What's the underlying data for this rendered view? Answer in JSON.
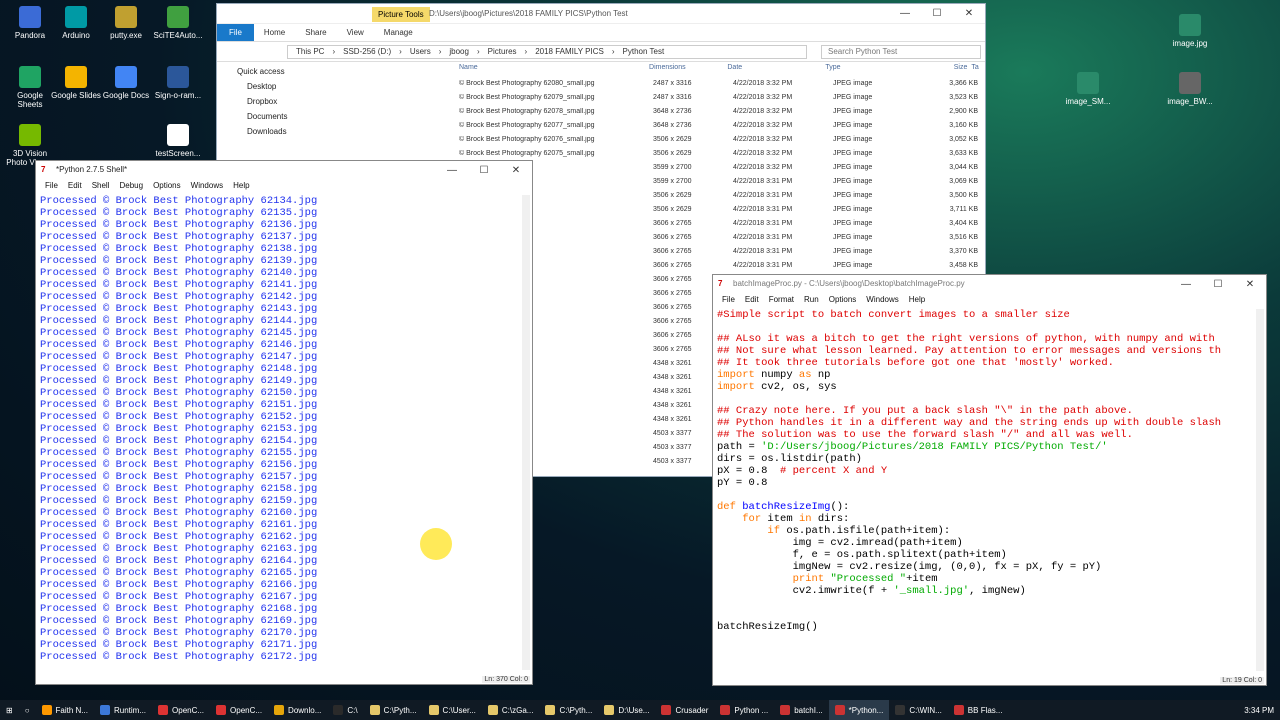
{
  "desktop_icons": [
    {
      "label": "Pandora",
      "color": "#3b6bd6"
    },
    {
      "label": "Arduino",
      "color": "#009aa5"
    },
    {
      "label": "putty.exe",
      "color": "#c0a030"
    },
    {
      "label": "SciTE4Auto...",
      "color": "#40a040"
    },
    {
      "label": "Google Sheets",
      "color": "#1fa463"
    },
    {
      "label": "Google Slides",
      "color": "#f4b400"
    },
    {
      "label": "Google Docs",
      "color": "#4285f4"
    },
    {
      "label": "Sign-o-ram...",
      "color": "#2b579a"
    },
    {
      "label": "3D Vision Photo Viewer",
      "color": "#76b900"
    },
    {
      "label": "testScreen...",
      "color": "#ffffff"
    },
    {
      "label": "image.jpg",
      "color": "#2a8a6a"
    },
    {
      "label": "image_SM...",
      "color": "#2a8a6a"
    },
    {
      "label": "image_BW...",
      "color": "#666666"
    }
  ],
  "explorer": {
    "title": "D:\\Users\\jboog\\Pictures\\2018 FAMILY PICS\\Python Test",
    "picture_tools": "Picture Tools",
    "ribbon_tabs": [
      "File",
      "Home",
      "Share",
      "View",
      "Manage"
    ],
    "breadcrumb": [
      "This PC",
      "SSD-256 (D:)",
      "Users",
      "jboog",
      "Pictures",
      "2018 FAMILY PICS",
      "Python Test"
    ],
    "search_placeholder": "Search Python Test",
    "nav_items": [
      "Quick access",
      "Desktop",
      "Dropbox",
      "Documents",
      "Downloads"
    ],
    "columns": [
      "Name",
      "Dimensions",
      "Date",
      "Type",
      "Size",
      "Ta"
    ],
    "files": [
      {
        "name": "© Brock Best Photography 62080_small.jpg",
        "dim": "2487 x 3316",
        "date": "4/22/2018 3:32 PM",
        "type": "JPEG image",
        "size": "3,366 KB"
      },
      {
        "name": "© Brock Best Photography 62079_small.jpg",
        "dim": "2487 x 3316",
        "date": "4/22/2018 3:32 PM",
        "type": "JPEG image",
        "size": "3,523 KB"
      },
      {
        "name": "© Brock Best Photography 62078_small.jpg",
        "dim": "3648 x 2736",
        "date": "4/22/2018 3:32 PM",
        "type": "JPEG image",
        "size": "2,900 KB"
      },
      {
        "name": "© Brock Best Photography 62077_small.jpg",
        "dim": "3648 x 2736",
        "date": "4/22/2018 3:32 PM",
        "type": "JPEG image",
        "size": "3,160 KB"
      },
      {
        "name": "© Brock Best Photography 62076_small.jpg",
        "dim": "3506 x 2629",
        "date": "4/22/2018 3:32 PM",
        "type": "JPEG image",
        "size": "3,052 KB"
      },
      {
        "name": "© Brock Best Photography 62075_small.jpg",
        "dim": "3506 x 2629",
        "date": "4/22/2018 3:32 PM",
        "type": "JPEG image",
        "size": "3,633 KB"
      },
      {
        "name": "graphy 62074_small.jpg",
        "dim": "3599 x 2700",
        "date": "4/22/2018 3:32 PM",
        "type": "JPEG image",
        "size": "3,044 KB"
      },
      {
        "name": "graphy 62073_small.jpg",
        "dim": "3599 x 2700",
        "date": "4/22/2018 3:31 PM",
        "type": "JPEG image",
        "size": "3,069 KB"
      },
      {
        "name": "graphy 62072_small.jpg",
        "dim": "3506 x 2629",
        "date": "4/22/2018 3:31 PM",
        "type": "JPEG image",
        "size": "3,500 KB"
      },
      {
        "name": "graphy 62071_small.jpg",
        "dim": "3506 x 2629",
        "date": "4/22/2018 3:31 PM",
        "type": "JPEG image",
        "size": "3,711 KB"
      },
      {
        "name": "graphy 62070_small.jpg",
        "dim": "3606 x 2765",
        "date": "4/22/2018 3:31 PM",
        "type": "JPEG image",
        "size": "3,404 KB"
      },
      {
        "name": "graphy 62069_small.jpg",
        "dim": "3606 x 2765",
        "date": "4/22/2018 3:31 PM",
        "type": "JPEG image",
        "size": "3,516 KB"
      },
      {
        "name": "graphy 62068_small.jpg",
        "dim": "3606 x 2765",
        "date": "4/22/2018 3:31 PM",
        "type": "JPEG image",
        "size": "3,370 KB"
      },
      {
        "name": "graphy 62067_small.jpg",
        "dim": "3606 x 2765",
        "date": "4/22/2018 3:31 PM",
        "type": "JPEG image",
        "size": "3,458 KB"
      },
      {
        "name": "graphy 62066_small.jpg",
        "dim": "3606 x 2765",
        "date": "",
        "type": "",
        "size": ""
      },
      {
        "name": "graphy 62065_small.jpg",
        "dim": "3606 x 2765",
        "date": "",
        "type": "",
        "size": ""
      },
      {
        "name": "graphy 62064_small.jpg",
        "dim": "3606 x 2765",
        "date": "",
        "type": "",
        "size": ""
      },
      {
        "name": "graphy 62063_small.jpg",
        "dim": "3606 x 2765",
        "date": "",
        "type": "",
        "size": ""
      },
      {
        "name": "graphy 62062_small.jpg",
        "dim": "3606 x 2765",
        "date": "",
        "type": "",
        "size": ""
      },
      {
        "name": "graphy 62061_small.jpg",
        "dim": "3606 x 2765",
        "date": "",
        "type": "",
        "size": ""
      },
      {
        "name": "graphy 62318.jpg",
        "dim": "4348 x 3261",
        "date": "",
        "type": "",
        "size": ""
      },
      {
        "name": "graphy 62319.jpg",
        "dim": "4348 x 3261",
        "date": "",
        "type": "",
        "size": ""
      },
      {
        "name": "graphy 62317.jpg",
        "dim": "4348 x 3261",
        "date": "",
        "type": "",
        "size": ""
      },
      {
        "name": "graphy 62315.jpg",
        "dim": "4348 x 3261",
        "date": "",
        "type": "",
        "size": ""
      },
      {
        "name": "graphy 62316.jpg",
        "dim": "4348 x 3261",
        "date": "",
        "type": "",
        "size": ""
      },
      {
        "name": "graphy 62309.jpg",
        "dim": "4503 x 3377",
        "date": "",
        "type": "",
        "size": ""
      },
      {
        "name": "graphy 62310.jpg",
        "dim": "4503 x 3377",
        "date": "",
        "type": "",
        "size": ""
      },
      {
        "name": "graphy 62311.jpg",
        "dim": "4503 x 3377",
        "date": "",
        "type": "",
        "size": ""
      }
    ]
  },
  "shell": {
    "title": "*Python 2.7.5 Shell*",
    "menu": [
      "File",
      "Edit",
      "Shell",
      "Debug",
      "Options",
      "Windows",
      "Help"
    ],
    "prefix": "Processed © Brock Best Photography",
    "start": 62134,
    "end": 62172,
    "status": "Ln: 370 Col: 0"
  },
  "editor": {
    "title": "batchImageProc.py - C:\\Users\\jboog\\Desktop\\batchImageProc.py",
    "menu": [
      "File",
      "Edit",
      "Format",
      "Run",
      "Options",
      "Windows",
      "Help"
    ],
    "status": "Ln: 19 Col: 0",
    "lines": [
      [
        [
          "cm",
          "#Simple script to batch convert images to a smaller size"
        ]
      ],
      [
        [
          "",
          ""
        ]
      ],
      [
        [
          "cm",
          "## ALso it was a bitch to get the right versions of python, with numpy and with"
        ]
      ],
      [
        [
          "cm",
          "## Not sure what lesson learned. Pay attention to error messages and versions th"
        ]
      ],
      [
        [
          "cm",
          "## It took three tutorials before got one that 'mostly' worked."
        ]
      ],
      [
        [
          "kw",
          "import"
        ],
        [
          "",
          " numpy "
        ],
        [
          "kw",
          "as"
        ],
        [
          "",
          " np"
        ]
      ],
      [
        [
          "kw",
          "import"
        ],
        [
          "",
          " cv2, os, sys"
        ]
      ],
      [
        [
          "",
          ""
        ]
      ],
      [
        [
          "cm",
          "## Crazy note here. If you put a back slash \"\\\" in the path above."
        ]
      ],
      [
        [
          "cm",
          "## Python handles it in a different way and the string ends up with double slash"
        ]
      ],
      [
        [
          "cm",
          "## The solution was to use the forward slash \"/\" and all was well."
        ]
      ],
      [
        [
          "",
          "path = "
        ],
        [
          "st",
          "'D:/Users/jboog/Pictures/2018 FAMILY PICS/Python Test/'"
        ]
      ],
      [
        [
          "",
          "dirs = os.listdir(path)"
        ]
      ],
      [
        [
          "",
          "pX = 0.8  "
        ],
        [
          "cm",
          "# percent X and Y"
        ]
      ],
      [
        [
          "",
          "pY = 0.8"
        ]
      ],
      [
        [
          "",
          ""
        ]
      ],
      [
        [
          "kw",
          "def"
        ],
        [
          "",
          " "
        ],
        [
          "fn",
          "batchResizeImg"
        ],
        [
          "",
          "():"
        ]
      ],
      [
        [
          "",
          "    "
        ],
        [
          "kw",
          "for"
        ],
        [
          "",
          " item "
        ],
        [
          "kw",
          "in"
        ],
        [
          "",
          " dirs:"
        ]
      ],
      [
        [
          "",
          "        "
        ],
        [
          "kw",
          "if"
        ],
        [
          "",
          " os.path.isfile(path+item):"
        ]
      ],
      [
        [
          "",
          "            img = cv2.imread(path+item)"
        ]
      ],
      [
        [
          "",
          "            f, e = os.path.splitext(path+item)"
        ]
      ],
      [
        [
          "",
          "            imgNew = cv2.resize(img, (0,0), fx = pX, fy = pY)"
        ]
      ],
      [
        [
          "",
          "            "
        ],
        [
          "kw",
          "print"
        ],
        [
          "",
          " "
        ],
        [
          "st",
          "\"Processed \""
        ],
        [
          "",
          "+item"
        ]
      ],
      [
        [
          "",
          "            cv2.imwrite(f + "
        ],
        [
          "st",
          "'_small.jpg'"
        ],
        [
          "",
          ", imgNew)"
        ]
      ],
      [
        [
          "",
          ""
        ]
      ],
      [
        [
          "",
          ""
        ]
      ],
      [
        [
          "",
          "batchResizeImg()"
        ]
      ]
    ]
  },
  "taskbar": {
    "items": [
      "Faith N...",
      "Runtim...",
      "OpenC...",
      "OpenC...",
      "Downlo...",
      "C:\\",
      "C:\\Pyth...",
      "C:\\User...",
      "C:\\zGa...",
      "C:\\Pyth...",
      "D:\\Use...",
      "Crusader",
      "Python ...",
      "batchI...",
      "*Python...",
      "C:\\WIN...",
      "BB Flas..."
    ],
    "active_index": 14,
    "clock": "3:34 PM"
  }
}
